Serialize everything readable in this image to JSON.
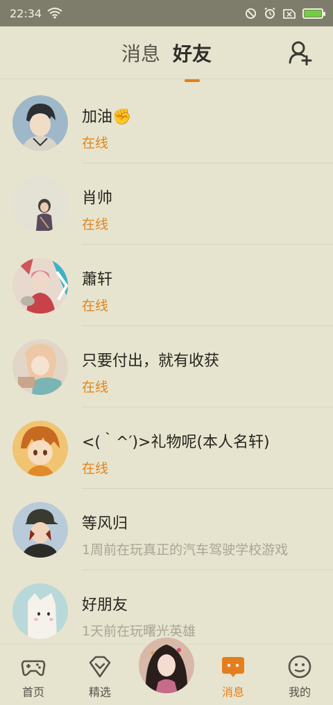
{
  "status_bar": {
    "time": "22:34"
  },
  "header": {
    "tabs": [
      {
        "label": "消息",
        "active": false
      },
      {
        "label": "好友",
        "active": true
      }
    ]
  },
  "friends": [
    {
      "name": "加油✊",
      "status": "在线",
      "online": true
    },
    {
      "name": "肖帅",
      "status": "在线",
      "online": true
    },
    {
      "name": "蕭轩",
      "status": "在线",
      "online": true
    },
    {
      "name": "只要付出，就有收获",
      "status": "在线",
      "online": true
    },
    {
      "name": "<(｀^′)>礼物呢(本人名轩)",
      "status": "在线",
      "online": true
    },
    {
      "name": "等风归",
      "status": "1周前在玩真正的汽车驾驶学校游戏",
      "online": false
    },
    {
      "name": "好朋友",
      "status": "1天前在玩曙光英雄",
      "online": false
    }
  ],
  "bottom_nav": {
    "items": [
      {
        "label": "首页",
        "icon": "gamepad-icon",
        "active": false
      },
      {
        "label": "精选",
        "icon": "heart-badge-icon",
        "active": false
      },
      {
        "label": "消息",
        "icon": "chat-bubble-icon",
        "active": true
      },
      {
        "label": "我的",
        "icon": "smiley-face-icon",
        "active": false
      }
    ]
  },
  "colors": {
    "accent": "#e47d1c",
    "background": "#e6e4ce",
    "online": "#e0861f",
    "offline": "#a8a696"
  }
}
